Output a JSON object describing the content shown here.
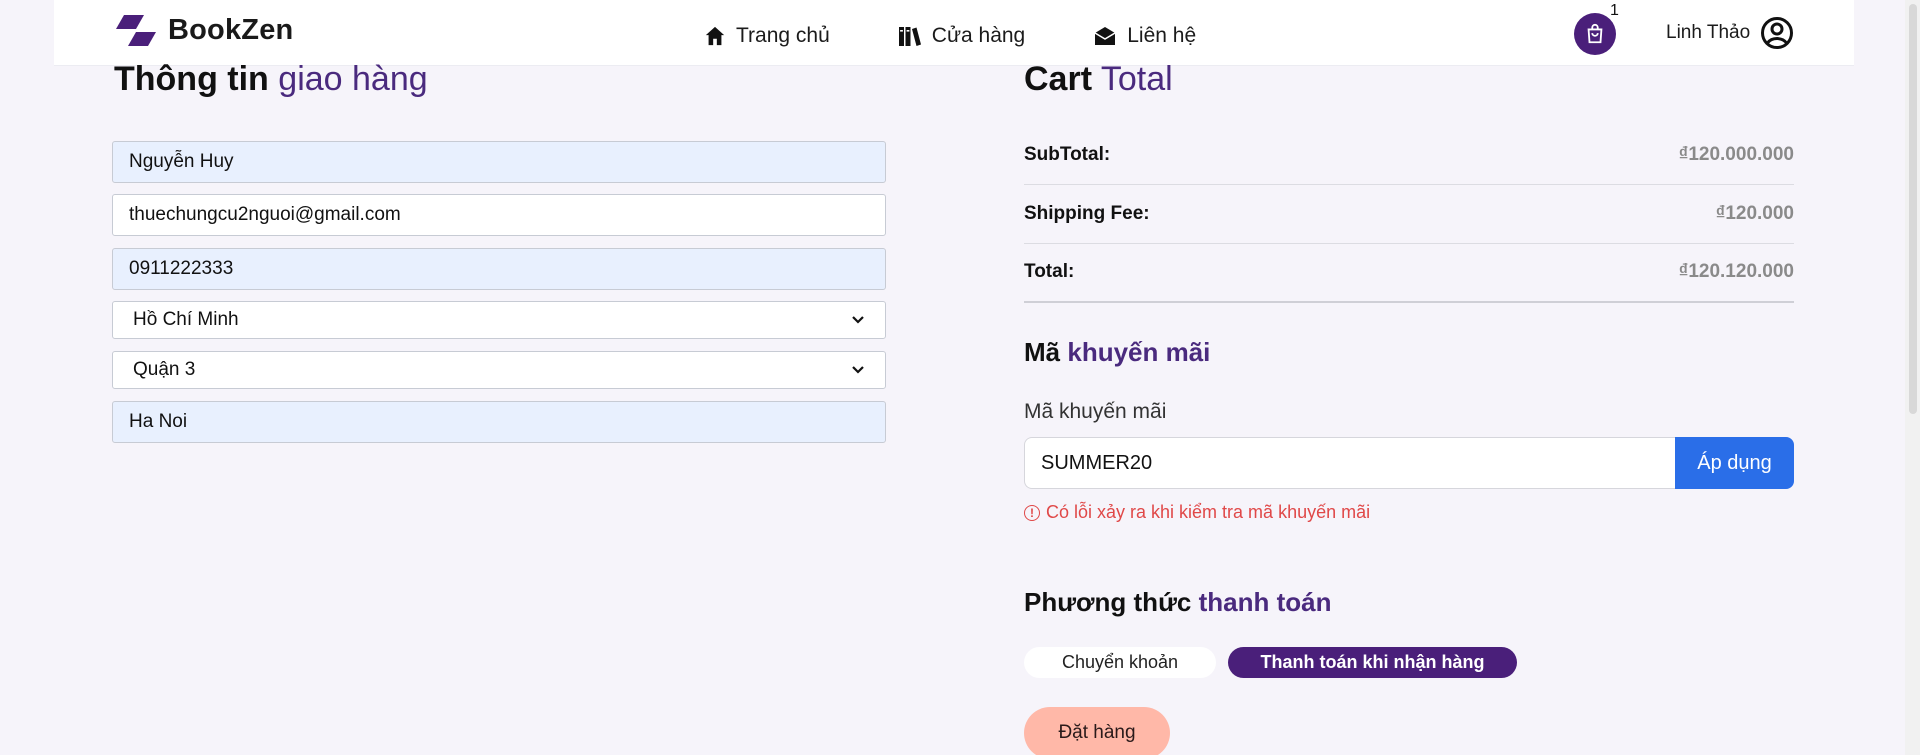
{
  "header": {
    "brand": "BookZen",
    "nav": [
      {
        "label": "Trang chủ",
        "icon": "home-icon"
      },
      {
        "label": "Cửa hàng",
        "icon": "books-icon"
      },
      {
        "label": "Liên hệ",
        "icon": "mail-icon"
      }
    ],
    "cart_count": "1",
    "user_name": "Linh Thảo"
  },
  "shipping": {
    "title_strong": "Thông tin",
    "title_light": "giao hàng",
    "full_name": "Nguyễn Huy",
    "email": "thuechungcu2nguoi@gmail.com",
    "phone": "0911222333",
    "city": "Hồ Chí Minh",
    "district": "Quận 3",
    "address": "Ha Noi"
  },
  "cart": {
    "title_strong": "Cart",
    "title_light": "Total",
    "subtotal_label": "SubTotal:",
    "subtotal": "₫120.000.000",
    "shipping_label": "Shipping Fee:",
    "shipping_fee": "₫120.000",
    "total_label": "Total:",
    "total": "₫120.120.000"
  },
  "promo": {
    "title_strong": "Mã",
    "title_accent": "khuyến mãi",
    "label": "Mã khuyến mãi",
    "code": "SUMMER20",
    "apply_label": "Áp dụng",
    "error": "Có lỗi xảy ra khi kiểm tra mã khuyến mãi"
  },
  "payment": {
    "title_strong": "Phương thức",
    "title_accent": "thanh toán",
    "options": [
      "Chuyển khoản",
      "Thanh toán khi nhận hàng"
    ],
    "selected": "Thanh toán khi nhận hàng"
  },
  "order": {
    "button_label": "Đặt hàng"
  },
  "colors": {
    "brand": "#4a1f7a",
    "accent_text": "#4a2a7e",
    "apply_button": "#2a6ee8",
    "error": "#e04848",
    "order_button": "#ffb8a8",
    "background": "#f6f4fa"
  }
}
